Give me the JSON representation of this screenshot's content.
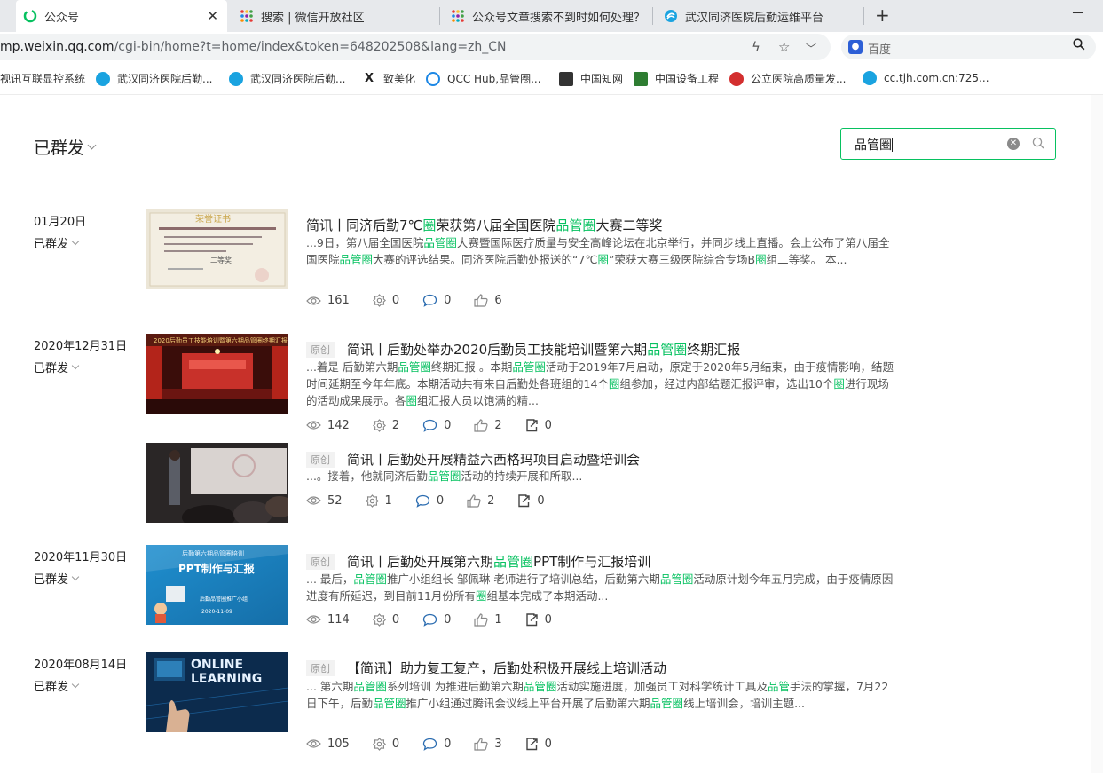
{
  "browser": {
    "tabs": [
      {
        "title": "公众号",
        "icon": "wechat-mp-icon",
        "color": "#07c160"
      },
      {
        "title": "搜索 | 微信开放社区",
        "icon": "grid-icon",
        "color": "#4caf50"
      },
      {
        "title": "公众号文章搜索不到时如何处理？ | 微",
        "icon": "grid-icon",
        "color": "#4caf50"
      },
      {
        "title": "武汉同济医院后勤运维平台",
        "icon": "hospital-logo-icon",
        "color": "#1aa3e0"
      }
    ],
    "url_prefix": "mp.weixin.qq.com",
    "url_rest": "/cgi-bin/home?t=home/index&token=648202508&lang=zh_CN",
    "search_engine": "百度",
    "bookmarks": [
      {
        "label": "视讯互联显控系统",
        "color": "#888"
      },
      {
        "label": "武汉同济医院后勤...",
        "color": "#1aa3e0"
      },
      {
        "label": "武汉同济医院后勤...",
        "color": "#1aa3e0"
      },
      {
        "label": "致美化",
        "color": "#222"
      },
      {
        "label": "QCC Hub,品管圈...",
        "color": "#1e88e5"
      },
      {
        "label": "中国知网",
        "color": "#333"
      },
      {
        "label": "中国设备工程",
        "color": "#2e7d32"
      },
      {
        "label": "公立医院高质量发...",
        "color": "#d32f2f"
      },
      {
        "label": "cc.tjh.com.cn:725...",
        "color": "#1aa3e0"
      }
    ]
  },
  "page": {
    "heading": "已群发",
    "search_value": "品管圈",
    "accent_color": "#07c160"
  },
  "groups": [
    {
      "date": "01月20日",
      "status": "已群发",
      "articles": [
        {
          "original": false,
          "title": [
            [
              "简讯丨同济后勤7℃",
              false
            ],
            [
              "圈",
              true
            ],
            [
              "荣获第八届全国医院",
              false
            ],
            [
              "品管圈",
              true
            ],
            [
              "大赛二等奖",
              false
            ]
          ],
          "digest": [
            [
              "...9日，第八届全国医院",
              false
            ],
            [
              "品管圈",
              true
            ],
            [
              "大赛暨国际医疗质量与安全高峰论坛在北京举行，并同步线上直播。会上公布了第八届全国医院",
              false
            ],
            [
              "品管圈",
              true
            ],
            [
              "大赛的评选结果。同济医院后勤处报送的“7℃",
              false
            ],
            [
              "圈",
              true
            ],
            [
              "”荣获大赛三级医院综合专场B",
              false
            ],
            [
              "圈",
              true
            ],
            [
              "组二等奖。 本...",
              false
            ]
          ],
          "views": "161",
          "shares": "0",
          "comments": "0",
          "likes": "6",
          "reposts": null,
          "thumb": "certificate"
        }
      ]
    },
    {
      "date": "2020年12月31日",
      "status": "已群发",
      "articles": [
        {
          "original": true,
          "title": [
            [
              "简讯丨后勤处举办2020后勤员工技能培训暨第六期",
              false
            ],
            [
              "品管圈",
              true
            ],
            [
              "终期汇报",
              false
            ]
          ],
          "digest": [
            [
              "...着是 后勤第六期",
              false
            ],
            [
              "品管圈",
              true
            ],
            [
              "终期汇报 。本期",
              false
            ],
            [
              "品管圈",
              true
            ],
            [
              "活动于2019年7月启动，原定于2020年5月结束，由于疫情影响，结题时间延期至今年年底。本期活动共有来自后勤处各班组的14个",
              false
            ],
            [
              "圈",
              true
            ],
            [
              "组参加，经过内部结题汇报评审，选出10个",
              false
            ],
            [
              "圈",
              true
            ],
            [
              "进行现场的活动成果展示。各",
              false
            ],
            [
              "圈",
              true
            ],
            [
              "组汇报人员以饱满的精...",
              false
            ]
          ],
          "views": "142",
          "shares": "2",
          "comments": "0",
          "likes": "2",
          "reposts": "0",
          "thumb": "stage"
        },
        {
          "original": true,
          "title": [
            [
              "简讯丨后勤处开展精益六西格玛项目启动暨培训会",
              false
            ]
          ],
          "digest": [
            [
              "...。接着，他就同济后勤",
              false
            ],
            [
              "品管圈",
              true
            ],
            [
              "活动的持续开展和所取...",
              false
            ]
          ],
          "views": "52",
          "shares": "1",
          "comments": "0",
          "likes": "2",
          "reposts": "0",
          "thumb": "speaker"
        }
      ]
    },
    {
      "date": "2020年11月30日",
      "status": "已群发",
      "articles": [
        {
          "original": true,
          "title": [
            [
              "简讯丨后勤处开展第六期",
              false
            ],
            [
              "品管圈",
              true
            ],
            [
              "PPT制作与汇报培训",
              false
            ]
          ],
          "digest": [
            [
              "... 最后，",
              false
            ],
            [
              "品管圈",
              true
            ],
            [
              "推广小组组长 邹佩琳 老师进行了培训总结，后勤第六期",
              false
            ],
            [
              "品管圈",
              true
            ],
            [
              "活动原计划今年五月完成，由于疫情原因进度有所延迟，到目前11月份所有",
              false
            ],
            [
              "圈",
              true
            ],
            [
              "组基本完成了本期活动...",
              false
            ]
          ],
          "views": "114",
          "shares": "0",
          "comments": "0",
          "likes": "1",
          "reposts": "0",
          "thumb": "ppt",
          "thumb_text": {
            "top": "后勤第六期品管圈培训",
            "main": "PPT制作与汇报",
            "sub": "后勤品管圈推广小组",
            "date": "2020-11-09"
          }
        }
      ]
    },
    {
      "date": "2020年08月14日",
      "status": "已群发",
      "articles": [
        {
          "original": true,
          "title": [
            [
              "【简讯】助力复工复产，后勤处积极开展线上培训活动",
              false
            ]
          ],
          "digest": [
            [
              "... 第六期",
              false
            ],
            [
              "品管圈",
              true
            ],
            [
              "系列培训 为推进后勤第六期",
              false
            ],
            [
              "品管圈",
              true
            ],
            [
              "活动实施进度，加强员工对科学统计工具及",
              false
            ],
            [
              "品管",
              true
            ],
            [
              "手法的掌握，7月22日下午，后勤",
              false
            ],
            [
              "品管圈",
              true
            ],
            [
              "推广小组通过腾讯会议线上平台开展了后勤第六期",
              false
            ],
            [
              "品管圈",
              true
            ],
            [
              "线上培训会，培训主题...",
              false
            ]
          ],
          "views": "105",
          "shares": "0",
          "comments": "0",
          "likes": "3",
          "reposts": "0",
          "thumb": "online",
          "thumb_text": {
            "line1": "ONLINE",
            "line2": "LEARNING"
          }
        }
      ]
    }
  ],
  "labels": {
    "original_tag": "原创"
  }
}
